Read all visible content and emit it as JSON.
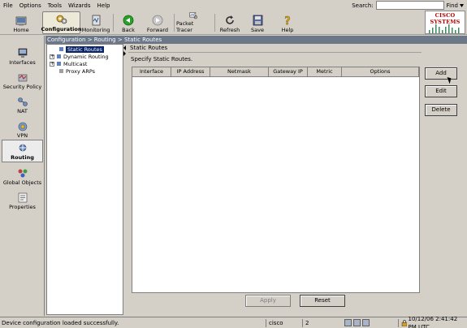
{
  "menubar": {
    "items": [
      "File",
      "Options",
      "Tools",
      "Wizards",
      "Help"
    ],
    "search_label": "Search:",
    "search_value": "",
    "find_label": "Find"
  },
  "toolbar": {
    "home": "Home",
    "configuration": "Configuration",
    "monitoring": "Monitoring",
    "back": "Back",
    "forward": "Forward",
    "packet_tracer": "Packet Tracer",
    "refresh": "Refresh",
    "save": "Save",
    "help": "Help"
  },
  "logo": {
    "text": "CISCO SYSTEMS"
  },
  "leftnav": {
    "items": [
      "Interfaces",
      "Security Policy",
      "NAT",
      "VPN",
      "Routing",
      "Global Objects",
      "Properties"
    ],
    "active": "Routing"
  },
  "breadcrumb": "Configuration > Routing > Static Routes",
  "tree": {
    "items": [
      "Static Routes",
      "Dynamic Routing",
      "Multicast",
      "Proxy ARPs"
    ],
    "selected": "Static Routes"
  },
  "main": {
    "title": "Static Routes",
    "instruction": "Specify Static Routes.",
    "columns": [
      "Interface",
      "IP Address",
      "Netmask",
      "Gateway IP",
      "Metric",
      "Options"
    ],
    "rows": []
  },
  "buttons": {
    "add": "Add",
    "edit": "Edit",
    "delete": "Delete",
    "apply": "Apply",
    "reset": "Reset"
  },
  "statusbar": {
    "message": "Device configuration loaded successfully.",
    "user": "cisco",
    "privilege": "2",
    "datetime": "10/12/06 2:41:42 PM UTC"
  },
  "colors": {
    "breadcrumb_bg": "#6c7888",
    "selection": "#0a246a",
    "logo_red": "#b00000"
  }
}
